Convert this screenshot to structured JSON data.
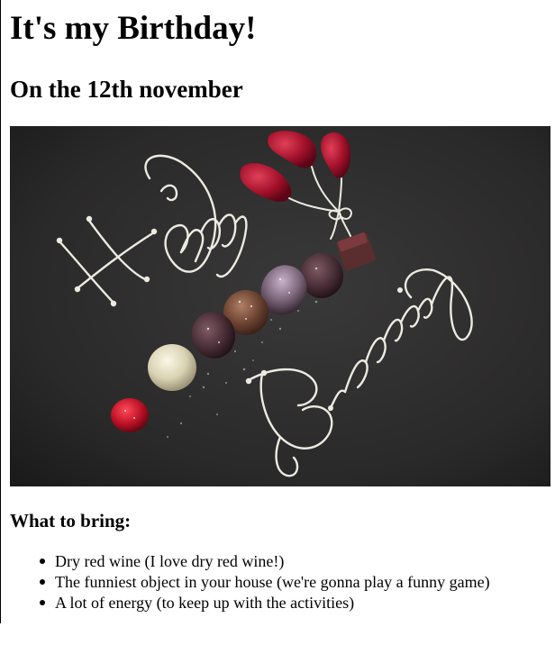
{
  "page": {
    "title": "It's my Birthday!",
    "subtitle": "On the 12th november",
    "image": {
      "icon": "birthday-cake-plate-photo",
      "lettering_top": "Happy",
      "lettering_bottom": "Birthday",
      "background_color": "#2b2a2a",
      "cream_color": "#ecebe2"
    },
    "bring": {
      "heading": "What to bring:",
      "items": [
        "Dry red wine (I love dry red wine!)",
        "The funniest object in your house (we're gonna play a funny game)",
        "A lot of energy (to keep up with the activities)"
      ]
    }
  }
}
